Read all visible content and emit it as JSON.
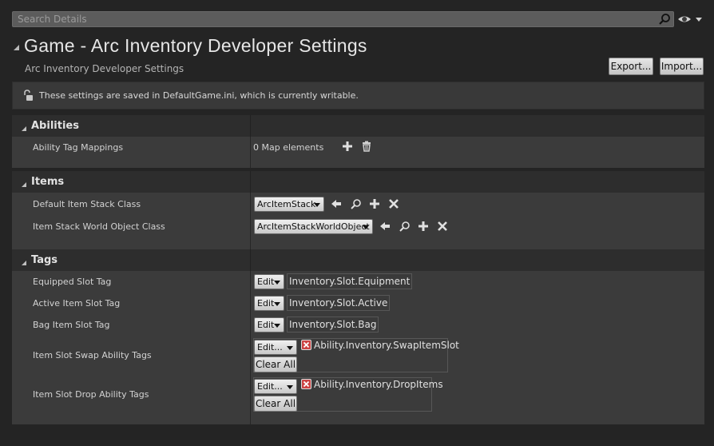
{
  "search": {
    "placeholder": "Search Details",
    "value": ""
  },
  "header": {
    "title": "Game - Arc Inventory Developer Settings",
    "subtitle": "Arc Inventory Developer Settings",
    "export_label": "Export...",
    "import_label": "Import..."
  },
  "info": {
    "text": "These settings are saved in DefaultGame.ini, which is currently writable."
  },
  "categories": {
    "abilities": {
      "title": "Abilities",
      "rows": [
        {
          "label": "Ability Tag Mappings",
          "value": "0 Map elements"
        }
      ]
    },
    "items": {
      "title": "Items",
      "rows": [
        {
          "label": "Default Item Stack Class",
          "value": "ArcItemStack"
        },
        {
          "label": "Item Stack World Object Class",
          "value": "ArcItemStackWorldObject"
        }
      ]
    },
    "tags": {
      "title": "Tags",
      "rows": [
        {
          "label": "Equipped Slot Tag",
          "edit": "Edit",
          "tag": "Inventory.Slot.Equipment"
        },
        {
          "label": "Active Item Slot Tag",
          "edit": "Edit",
          "tag": "Inventory.Slot.Active"
        },
        {
          "label": "Bag Item Slot Tag",
          "edit": "Edit",
          "tag": "Inventory.Slot.Bag"
        },
        {
          "label": "Item Slot Swap Ability Tags",
          "edit": "Edit...",
          "tag": "Ability.Inventory.SwapItemSlot",
          "clear": "Clear All"
        },
        {
          "label": "Item Slot Drop Ability Tags",
          "edit": "Edit...",
          "tag": "Ability.Inventory.DropItems",
          "clear": "Clear All"
        }
      ]
    }
  },
  "icons": {
    "search": "search-icon",
    "eye": "eye-icon",
    "lock": "unlock-icon",
    "add": "plus-icon",
    "delete": "trash-icon",
    "use": "arrow-left-icon",
    "browse": "search-icon",
    "new": "plus-icon",
    "clear": "x-icon"
  },
  "colors": {
    "background": "#242424",
    "panel": "#3b3b3b",
    "category_header": "#2d2d2d",
    "remove_tag": "#c44444"
  }
}
